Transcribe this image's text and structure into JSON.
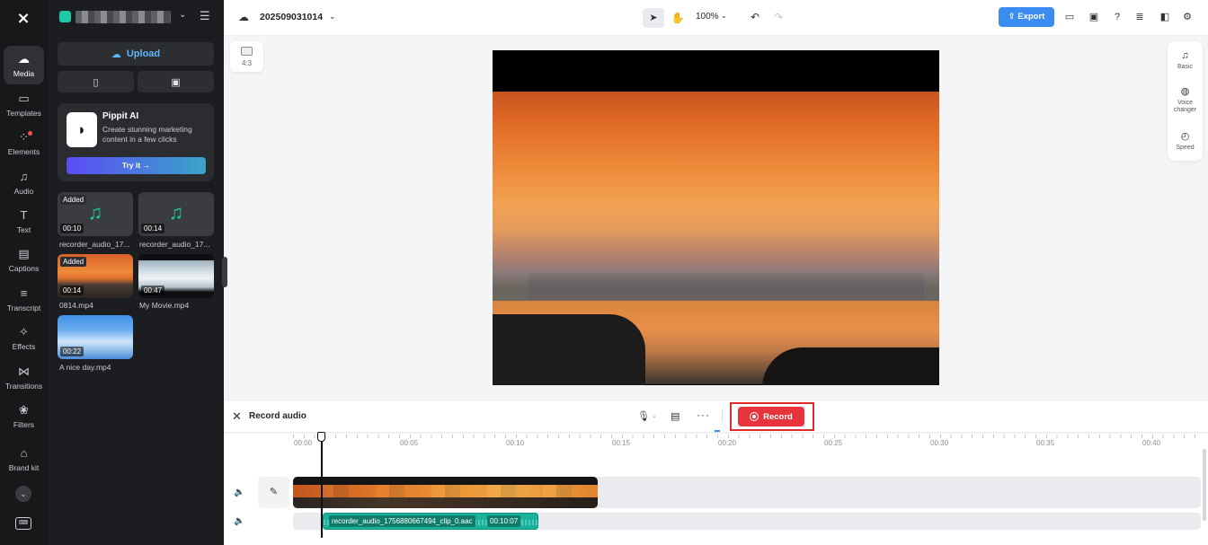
{
  "rail": {
    "items": [
      {
        "label": "Media",
        "icon": "☁"
      },
      {
        "label": "Templates",
        "icon": "▭"
      },
      {
        "label": "Elements",
        "icon": "⁘"
      },
      {
        "label": "Audio",
        "icon": "♫"
      },
      {
        "label": "Text",
        "icon": "T"
      },
      {
        "label": "Captions",
        "icon": "▤"
      },
      {
        "label": "Transcript",
        "icon": "≡"
      },
      {
        "label": "Effects",
        "icon": "✧"
      },
      {
        "label": "Transitions",
        "icon": "⋈"
      },
      {
        "label": "Filters",
        "icon": "❀"
      },
      {
        "label": "Brand kit",
        "icon": "⌂"
      }
    ],
    "active": "Media"
  },
  "panel": {
    "upload_label": "Upload",
    "promo": {
      "title": "Pippit AI",
      "desc": "Create stunning marketing content in a few clicks",
      "cta": "Try it →"
    },
    "media": [
      {
        "name": "recorder_audio_17...",
        "duration": "00:10",
        "added": "Added",
        "kind": "audio"
      },
      {
        "name": "recorder_audio_17...",
        "duration": "00:14",
        "added": "",
        "kind": "audio"
      },
      {
        "name": "0814.mp4",
        "duration": "00:14",
        "added": "Added",
        "kind": "sunset"
      },
      {
        "name": "My Movie.mp4",
        "duration": "00:47",
        "added": "",
        "kind": "beach"
      },
      {
        "name": "A nice day.mp4",
        "duration": "00:22",
        "added": "",
        "kind": "sky"
      }
    ]
  },
  "topbar": {
    "project_title": "202509031014",
    "zoom": "100%",
    "export_label": "⇪ Export"
  },
  "canvas": {
    "ratio": "4:3"
  },
  "side_tools": [
    {
      "label": "Basic",
      "icon": "♫"
    },
    {
      "label": "Voice changer",
      "icon": "◍"
    },
    {
      "label": "Speed",
      "icon": "◴"
    }
  ],
  "record": {
    "title": "Record audio",
    "button": "Record"
  },
  "timeline": {
    "ruler": [
      "00:00",
      "00:05",
      "00:10",
      "00:15",
      "00:20",
      "00:25",
      "00:30",
      "00:35",
      "00:40"
    ],
    "audio_clip": {
      "name": "recorder_audio_1756880667494_clip_0.aac",
      "duration": "00:10:07"
    }
  },
  "colors": {
    "accent": "#3b8cf0",
    "record": "#e8333b",
    "audio_clip": "#18b39a",
    "rail_bg": "#17181a"
  }
}
